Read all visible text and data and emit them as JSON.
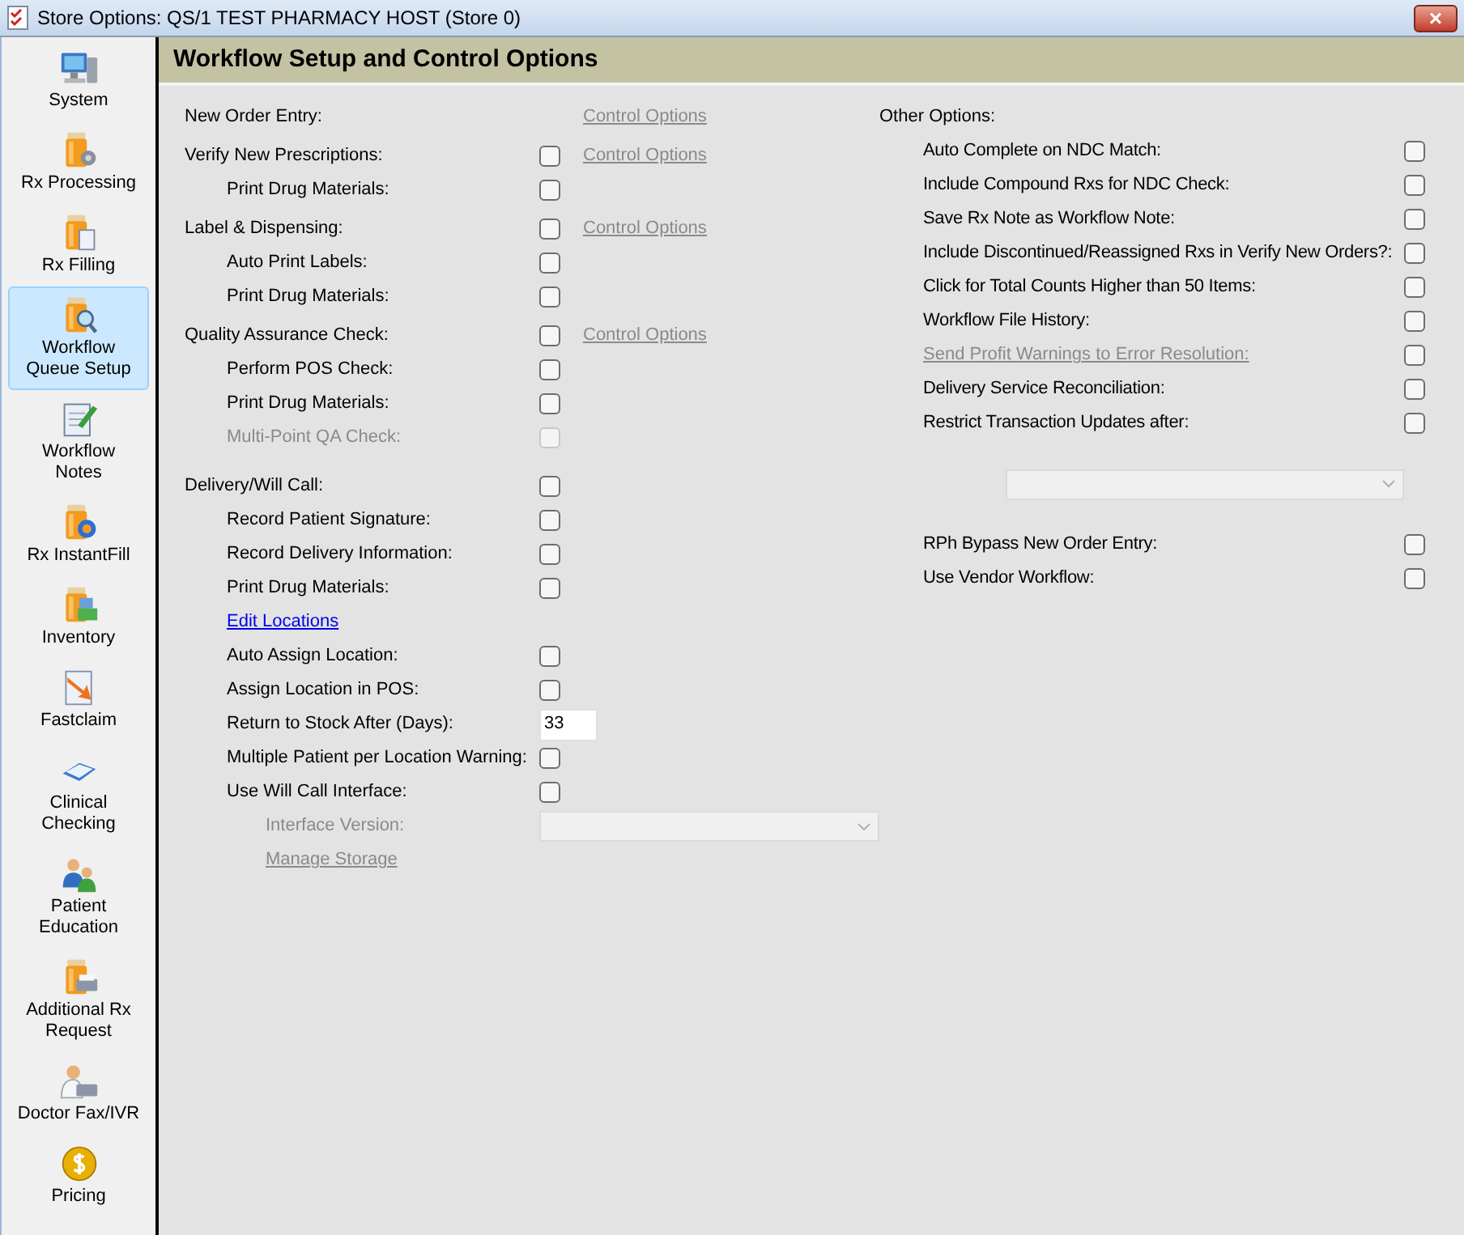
{
  "window": {
    "title": "Store Options: QS/1 TEST PHARMACY HOST (Store 0)",
    "close": "×"
  },
  "sidebar": {
    "items": [
      {
        "lines": [
          "System"
        ],
        "selected": false
      },
      {
        "lines": [
          "Rx Processing"
        ],
        "selected": false
      },
      {
        "lines": [
          "Rx Filling"
        ],
        "selected": false
      },
      {
        "lines": [
          "Workflow",
          "Queue Setup"
        ],
        "selected": true
      },
      {
        "lines": [
          "Workflow",
          "Notes"
        ],
        "selected": false
      },
      {
        "lines": [
          "Rx InstantFill"
        ],
        "selected": false
      },
      {
        "lines": [
          "Inventory"
        ],
        "selected": false
      },
      {
        "lines": [
          "Fastclaim"
        ],
        "selected": false
      },
      {
        "lines": [
          "Clinical",
          "Checking"
        ],
        "selected": false
      },
      {
        "lines": [
          "Patient",
          "Education"
        ],
        "selected": false
      },
      {
        "lines": [
          "Additional Rx",
          "Request"
        ],
        "selected": false
      },
      {
        "lines": [
          "Doctor Fax/IVR"
        ],
        "selected": false
      },
      {
        "lines": [
          "Pricing"
        ],
        "selected": false
      }
    ]
  },
  "panel": {
    "title": "Workflow Setup and Control Options",
    "left_groups": [
      {
        "kind": "heading",
        "label": "New Order Entry:",
        "link": {
          "text": "Control Options",
          "disabled": true
        }
      },
      {
        "kind": "checkbox",
        "label": "Verify New Prescriptions:",
        "checked": false,
        "disabled": false,
        "link": {
          "text": "Control Options",
          "disabled": true
        },
        "children": [
          {
            "kind": "checkbox",
            "label": "Print Drug Materials:",
            "checked": false,
            "disabled": false
          }
        ]
      },
      {
        "kind": "checkbox",
        "label": "Label & Dispensing:",
        "checked": false,
        "disabled": false,
        "link": {
          "text": "Control Options",
          "disabled": true
        },
        "children": [
          {
            "kind": "checkbox",
            "label": "Auto Print Labels:",
            "checked": false,
            "disabled": false
          },
          {
            "kind": "checkbox",
            "label": "Print Drug Materials:",
            "checked": false,
            "disabled": false
          }
        ]
      },
      {
        "kind": "checkbox",
        "label": "Quality Assurance Check:",
        "checked": false,
        "disabled": false,
        "link": {
          "text": "Control Options",
          "disabled": true
        },
        "children": [
          {
            "kind": "checkbox",
            "label": "Perform POS Check:",
            "checked": false,
            "disabled": false
          },
          {
            "kind": "checkbox",
            "label": "Print Drug Materials:",
            "checked": false,
            "disabled": false
          },
          {
            "kind": "checkbox",
            "label": "Multi-Point QA Check:",
            "checked": false,
            "disabled": true
          }
        ]
      },
      {
        "kind": "checkbox",
        "label": "Delivery/Will Call:",
        "checked": false,
        "disabled": false,
        "children": [
          {
            "kind": "checkbox",
            "label": "Record Patient Signature:",
            "checked": false,
            "disabled": false
          },
          {
            "kind": "checkbox",
            "label": "Record Delivery Information:",
            "checked": false,
            "disabled": false
          },
          {
            "kind": "checkbox",
            "label": "Print Drug Materials:",
            "checked": false,
            "disabled": false
          },
          {
            "kind": "link",
            "label": "Edit Locations",
            "disabled": false
          },
          {
            "kind": "checkbox",
            "label": "Auto Assign Location:",
            "checked": false,
            "disabled": false
          },
          {
            "kind": "checkbox",
            "label": "Assign Location in POS:",
            "checked": false,
            "disabled": false
          },
          {
            "kind": "number",
            "label": "Return to Stock After (Days):",
            "value": "33"
          },
          {
            "kind": "checkbox",
            "label": "Multiple Patient per Location Warning:",
            "checked": false,
            "disabled": false
          },
          {
            "kind": "checkbox",
            "label": "Use Will Call Interface:",
            "checked": false,
            "disabled": false,
            "children": [
              {
                "kind": "select",
                "label": "Interface Version:",
                "disabled": true
              },
              {
                "kind": "link",
                "label": "Manage Storage",
                "disabled": true
              }
            ]
          }
        ]
      }
    ],
    "other_options": {
      "label": "Other Options:",
      "children": [
        {
          "kind": "checkbox",
          "label": "Auto Complete on NDC Match:",
          "checked": false,
          "disabled": false
        },
        {
          "kind": "checkbox",
          "label": "Include Compound Rxs for NDC Check:",
          "checked": false,
          "disabled": false
        },
        {
          "kind": "checkbox",
          "label": "Save Rx Note as Workflow Note:",
          "checked": false,
          "disabled": false
        },
        {
          "kind": "checkbox",
          "label": "Include Discontinued/Reassigned Rxs in Verify New Orders?:",
          "checked": false,
          "disabled": false
        },
        {
          "kind": "checkbox",
          "label": "Click for Total Counts Higher than 50 Items:",
          "checked": false,
          "disabled": false
        },
        {
          "kind": "checkbox",
          "label": "Workflow File History:",
          "checked": false,
          "disabled": false
        },
        {
          "kind": "link_checkbox",
          "label": "Send Profit Warnings to Error Resolution:",
          "link_disabled": true,
          "checked": false,
          "disabled": false
        },
        {
          "kind": "checkbox",
          "label": "Delivery Service Reconciliation:",
          "checked": false,
          "disabled": false
        },
        {
          "kind": "checkbox",
          "label": "Restrict Transaction Updates after:",
          "checked": false,
          "disabled": false
        },
        {
          "kind": "select",
          "disabled": true
        },
        {
          "kind": "checkbox",
          "label": "RPh Bypass New Order Entry:",
          "checked": false,
          "disabled": false
        },
        {
          "kind": "checkbox",
          "label": "Use Vendor Workflow:",
          "checked": false,
          "disabled": false
        }
      ]
    }
  }
}
